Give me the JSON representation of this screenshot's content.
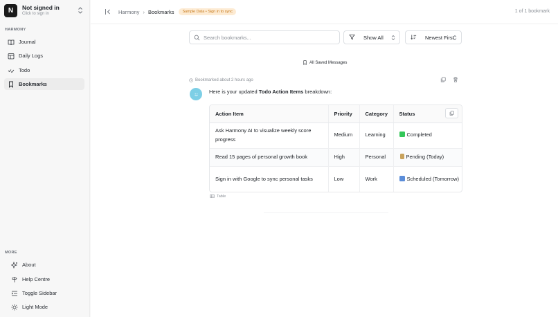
{
  "account": {
    "avatar_letter": "N",
    "name": "Not signed in",
    "subtitle": "Click to sign in"
  },
  "sidebar": {
    "section_label": "HARMONY",
    "items": [
      {
        "label": "Journal",
        "icon": "book-open-icon"
      },
      {
        "label": "Daily Logs",
        "icon": "calendar-grid-icon"
      },
      {
        "label": "Todo",
        "icon": "check-list-icon"
      },
      {
        "label": "Bookmarks",
        "icon": "bookmark-icon",
        "active": true
      }
    ],
    "more_label": "MORE",
    "more_items": [
      {
        "label": "About",
        "icon": "sparkles-icon"
      },
      {
        "label": "Help Centre",
        "icon": "signpost-icon"
      },
      {
        "label": "Toggle Sidebar",
        "icon": "list-indent-icon"
      },
      {
        "label": "Light Mode",
        "icon": "sun-icon"
      }
    ]
  },
  "header": {
    "breadcrumb_root": "Harmony",
    "breadcrumb_current": "Bookmarks",
    "badge": "Sample Data • Sign in to sync",
    "pager": "1 of 1 bookmark"
  },
  "toolbar": {
    "search_placeholder": "Search bookmarks...",
    "filter_label": "Show All",
    "sort_label": "Newest First"
  },
  "content": {
    "all_saved_label": "All Saved Messages",
    "bookmark_meta": "Bookmarked about 2 hours ago",
    "message_prefix": "Here is your updated ",
    "message_bold": "Todo Action Items",
    "message_suffix": " breakdown:",
    "table": {
      "headers": [
        "Action Item",
        "Priority",
        "Category",
        "Status"
      ],
      "rows": [
        {
          "item": "Ask Harmony AI to visualize weekly score progress",
          "priority": "Medium",
          "category": "Learning",
          "status": "Completed",
          "status_color": "#34c759"
        },
        {
          "item": "Read 15 pages of personal growth book",
          "priority": "High",
          "category": "Personal",
          "status": "Pending (Today)",
          "status_color": "#c8a25c"
        },
        {
          "item": "Sign in with Google to sync personal tasks",
          "priority": "Low",
          "category": "Work",
          "status": "Scheduled (Tomorrow)",
          "status_color": "#5b8dd9"
        }
      ]
    },
    "table_caption": "Table"
  },
  "colors": {
    "accent_badge_bg": "#fdebd3",
    "accent_badge_text": "#c77a1c",
    "avatar_bg": "#7dcfe6"
  }
}
